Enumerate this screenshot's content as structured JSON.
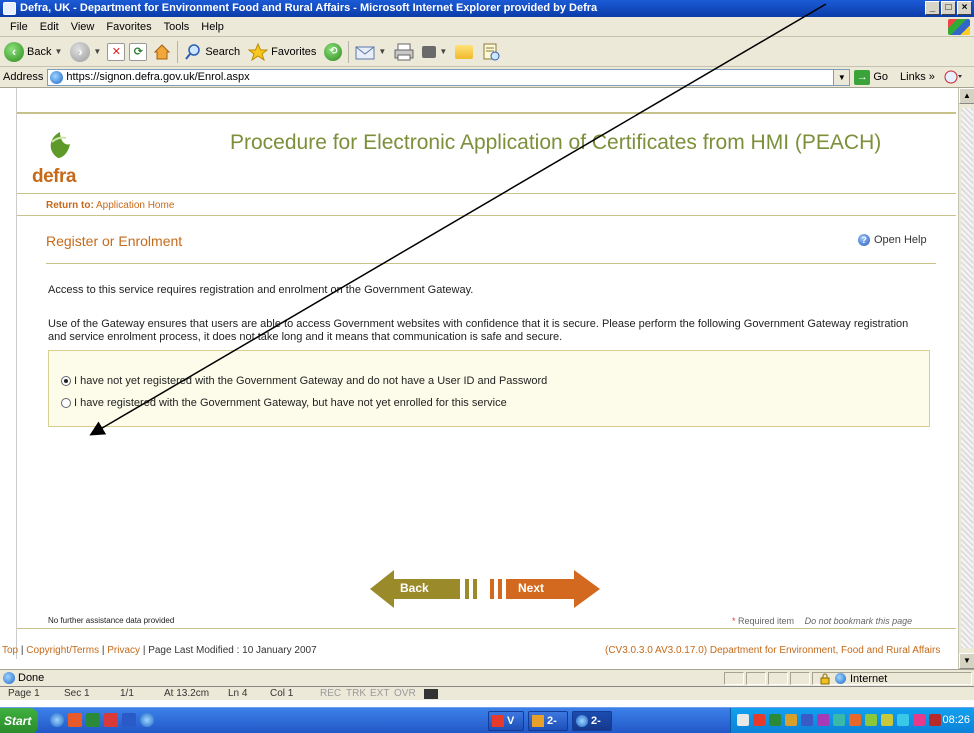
{
  "window": {
    "title": "Defra, UK - Department for Environment Food and Rural Affairs - Microsoft Internet Explorer provided by Defra",
    "minimize": "_",
    "maximize": "□",
    "close": "×"
  },
  "menu": [
    "File",
    "Edit",
    "View",
    "Favorites",
    "Tools",
    "Help"
  ],
  "toolbar": {
    "back_label": "Back",
    "search_label": "Search",
    "favorites_label": "Favorites"
  },
  "address": {
    "label": "Address",
    "url": "https://signon.defra.gov.uk/Enrol.aspx",
    "go_label": "Go",
    "links_label": "Links"
  },
  "page": {
    "logo_text": "defra",
    "site_title": "Procedure for Electronic Application of Certificates from HMI (PEACH)",
    "return_label": "Return to:",
    "return_link": "Application Home",
    "section_title": "Register or Enrolment",
    "help_label": "Open Help",
    "para1": "Access to this service requires registration and enrolment on the Government Gateway.",
    "para2": "Use of the Gateway ensures that users are able to access Government websites with confidence that it is secure. Please perform the following Government Gateway registration and service enrolment process, it does not take long and it means that communication is safe and secure.",
    "options": [
      {
        "label": "I have not yet registered with the Government Gateway and do not have a User ID and Password",
        "selected": true
      },
      {
        "label": "I have registered with the Government Gateway, but have not yet enrolled for this service",
        "selected": false
      }
    ],
    "back_button": "Back",
    "next_button": "Next",
    "no_further": "No further assistance data provided",
    "required_star": "*",
    "required_item": "Required item",
    "no_bookmark": "Do not bookmark this page"
  },
  "footer": {
    "top": "Top",
    "copyright": "Copyright/Terms",
    "privacy": "Privacy",
    "modified": "Page Last Modified : 10 January 2007",
    "version": "(CV3.0.3.0 AV3.0.17.0) Department for Environment, Food and Rural Affairs"
  },
  "status": {
    "text": "Done",
    "zone": "Internet"
  },
  "word_status": {
    "page": "Page 1",
    "sec": "Sec 1",
    "pages": "1/1",
    "at": "At 13.2cm",
    "ln": "Ln 4",
    "col": "Col 1",
    "rec": "REC",
    "trk": "TRK",
    "ext": "EXT",
    "ovr": "OVR"
  },
  "taskbar": {
    "start": "Start",
    "task1": "V",
    "task2": "2-",
    "task3": "2-",
    "clock": "08:26"
  },
  "colors": {
    "accent_orange": "#c66a1a",
    "accent_olive": "#7c8f3a",
    "next_button": "#d2691e",
    "back_button": "#9a8a2a"
  }
}
